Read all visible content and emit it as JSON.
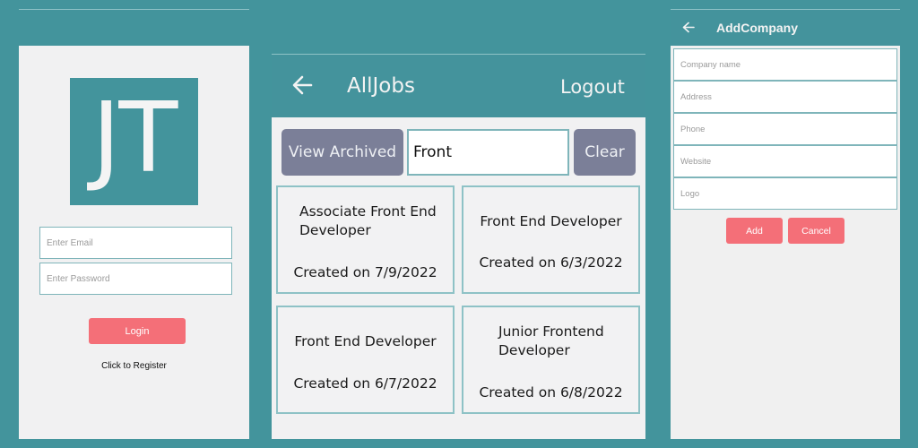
{
  "login": {
    "logo_text": "JT",
    "email_placeholder": "Enter Email",
    "password_placeholder": "Enter Password",
    "login_label": "Login",
    "register_label": "Click to Register"
  },
  "jobs": {
    "title": "AllJobs",
    "logout_label": "Logout",
    "view_archived_label": "View Archived",
    "search_value": "Front",
    "clear_label": "Clear",
    "cards": [
      {
        "title_line1": "Associate Front End",
        "title_line2": "Developer",
        "date": "Created on 7/9/2022"
      },
      {
        "title_line1": "Front End Developer",
        "title_line2": "",
        "date": "Created on 6/3/2022"
      },
      {
        "title_line1": "Front End Developer",
        "title_line2": "",
        "date": "Created on 6/7/2022"
      },
      {
        "title_line1": "Junior Frontend",
        "title_line2": "Developer",
        "date": "Created on 6/8/2022"
      }
    ]
  },
  "add_company": {
    "title": "AddCompany",
    "fields": [
      {
        "placeholder": "Company name"
      },
      {
        "placeholder": "Address"
      },
      {
        "placeholder": "Phone"
      },
      {
        "placeholder": "Website"
      },
      {
        "placeholder": "Logo"
      }
    ],
    "add_label": "Add",
    "cancel_label": "Cancel"
  },
  "colors": {
    "background_teal": "#43949c",
    "button_pink": "#f46f78",
    "button_slate": "#7b7f98",
    "border_teal": "#7fb5ba"
  },
  "icons": {
    "back": "back-arrow-icon"
  }
}
